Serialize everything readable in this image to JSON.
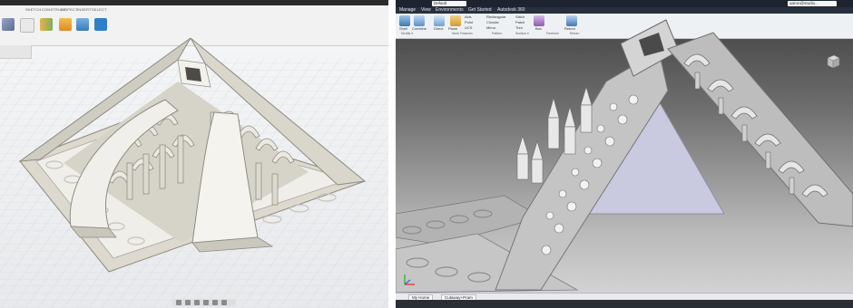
{
  "fusion": {
    "toolbar_tabs": [
      "SKETCH",
      "CONSTRUCT",
      "INSPECT",
      "INSERT",
      "SELECT"
    ]
  },
  "inventor": {
    "menu": [
      "Manage",
      "View",
      "Environments",
      "Get Started",
      "Autodesk 360"
    ],
    "document_dropdown": "Default",
    "search_box": "aaron@studio...",
    "modify": {
      "shell": "Shell",
      "combine": "Combine",
      "direct": "Direct",
      "plane": "Plane",
      "axis": "Axis",
      "point": "Point",
      "ucs": "UCS"
    },
    "pattern": {
      "rectangular": "Rectangular",
      "circular": "Circular",
      "mirror": "Mirror"
    },
    "surface": {
      "stitch": "Stitch",
      "patch": "Patch",
      "trim": "Trim"
    },
    "freeform": {
      "box": "Box"
    },
    "return": "Return",
    "groups": [
      "Modify ▾",
      "Work Features",
      "Pattern",
      "Surface ▾",
      "Freeform",
      "Return"
    ],
    "doc_tabs": [
      "My Home",
      "Cutaway+Pram"
    ]
  },
  "colors": {
    "fusion_toolbar": "#f2f2f2",
    "inventor_ribbon": "#eef1f4",
    "inventor_header": "#1d2430",
    "model_fill": "#e4e3dc",
    "model_shadow": "#b7b5ac",
    "inventor_model": "#cfcfcf"
  }
}
